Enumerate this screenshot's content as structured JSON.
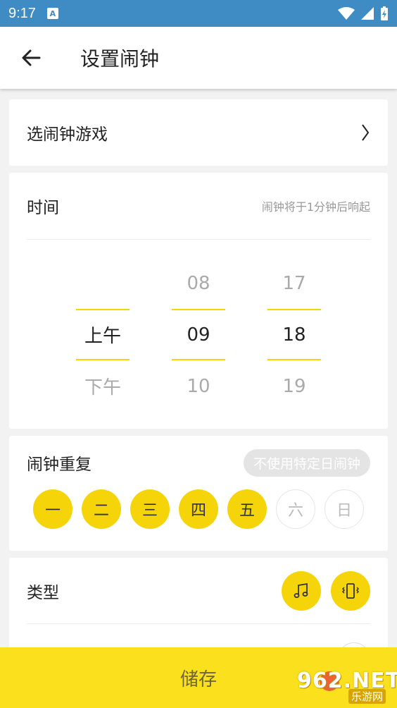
{
  "status_bar": {
    "time": "9:17",
    "notification_icon": "A"
  },
  "app_bar": {
    "title": "设置闹钟"
  },
  "game_card": {
    "label": "选闹钟游戏"
  },
  "time_card": {
    "label": "时间",
    "hint": "闹钟将于1分钟后响起",
    "ampm": {
      "prev": "",
      "selected": "上午",
      "next": "下午"
    },
    "hour": {
      "prev": "08",
      "selected": "09",
      "next": "10"
    },
    "minute": {
      "prev": "17",
      "selected": "18",
      "next": "19"
    }
  },
  "repeat_card": {
    "label": "闹钟重复",
    "pill": "不使用特定日闹钟",
    "days": [
      {
        "label": "一",
        "on": true
      },
      {
        "label": "二",
        "on": true
      },
      {
        "label": "三",
        "on": true
      },
      {
        "label": "四",
        "on": true
      },
      {
        "label": "五",
        "on": true
      },
      {
        "label": "六",
        "on": false
      },
      {
        "label": "日",
        "on": false
      }
    ]
  },
  "type_card": {
    "label": "类型",
    "icons": [
      "music-note-icon",
      "vibrate-icon"
    ]
  },
  "save_button": {
    "label": "储存"
  },
  "watermark": {
    "brand": "962.NET",
    "sub": "乐游网"
  },
  "colors": {
    "accent": "#f5d50a",
    "status_bar": "#3f8bc4",
    "save_bar": "#fbe01d"
  }
}
